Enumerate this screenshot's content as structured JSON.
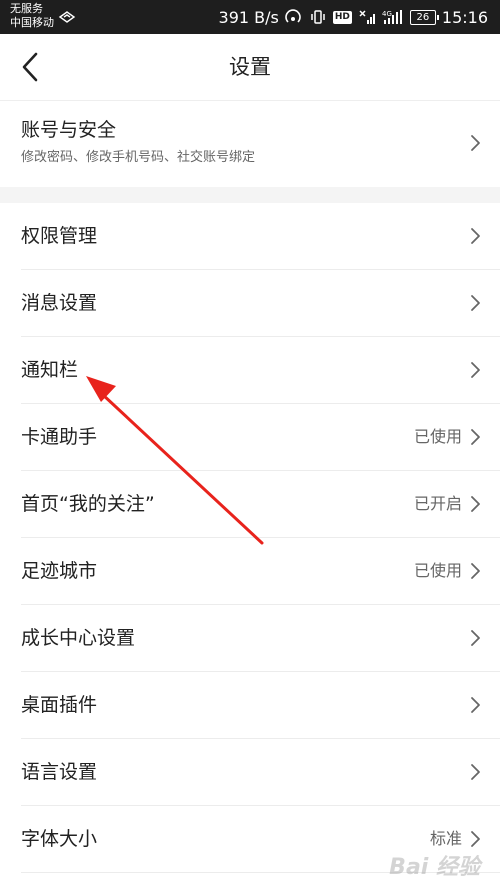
{
  "status_bar": {
    "carrier_line1": "无服务",
    "carrier_line2": "中国移动",
    "speed": "391 B/s",
    "hd": "HD",
    "battery": "26",
    "time": "15:16"
  },
  "header": {
    "title": "设置",
    "back_icon": "chevron-left-icon"
  },
  "account": {
    "title": "账号与安全",
    "subtitle": "修改密码、修改手机号码、社交账号绑定"
  },
  "items": [
    {
      "label": "权限管理",
      "value": ""
    },
    {
      "label": "消息设置",
      "value": ""
    },
    {
      "label": "通知栏",
      "value": ""
    },
    {
      "label": "卡通助手",
      "value": "已使用"
    },
    {
      "label": "首页“我的关注”",
      "value": "已开启"
    },
    {
      "label": "足迹城市",
      "value": "已使用"
    },
    {
      "label": "成长中心设置",
      "value": ""
    },
    {
      "label": "桌面插件",
      "value": ""
    },
    {
      "label": "语言设置",
      "value": ""
    },
    {
      "label": "字体大小",
      "value": "标准"
    }
  ],
  "colors": {
    "status_bar_bg": "#1e1e1e",
    "annotation_arrow": "#e8231c",
    "section_gap": "#f4f4f4"
  }
}
